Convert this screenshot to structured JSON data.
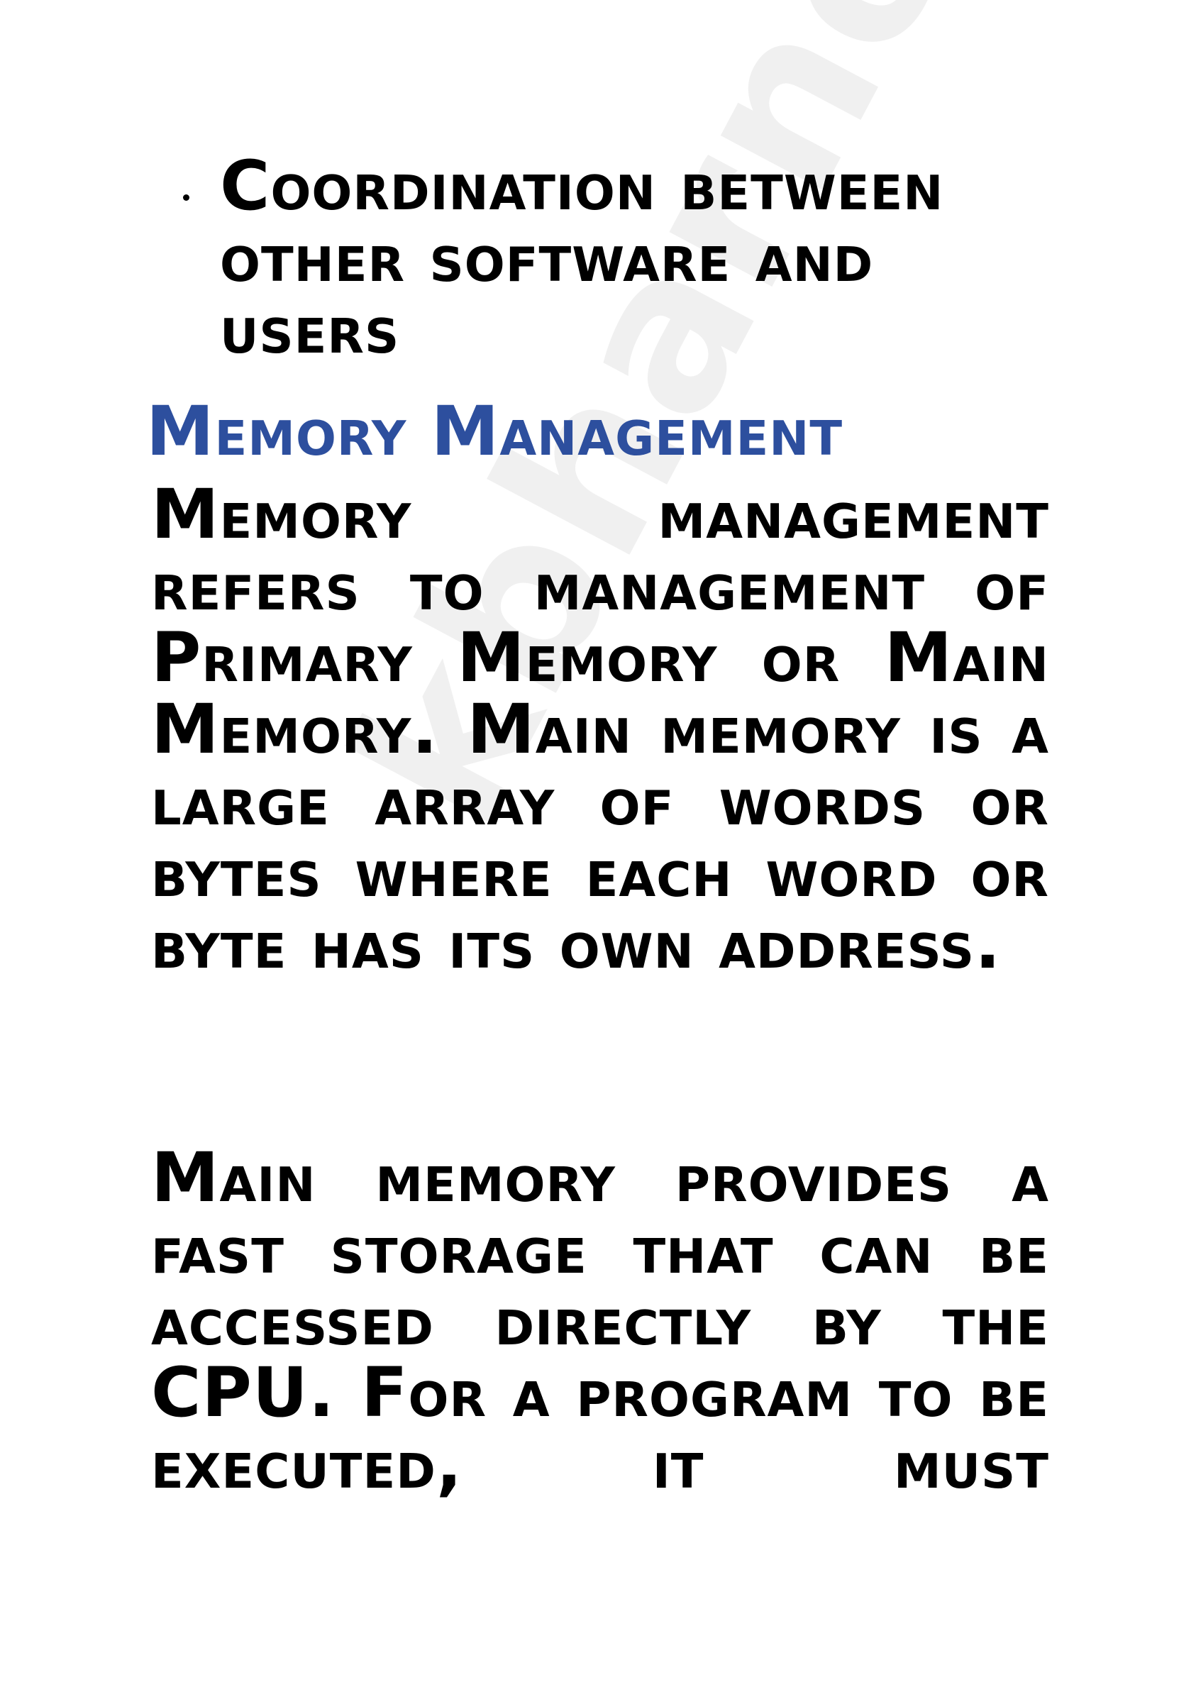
{
  "bullet": {
    "text": "Coordination between other software and users"
  },
  "section": {
    "heading": "Memory Management"
  },
  "paragraphs": [
    "Memory management refers to management of Primary Memory or Main Memory. Main memory is a large array of words or bytes where each word or byte has its own address.",
    "Main memory provides a fast storage that can be accessed directly by the CPU. For a program to be executed, it must"
  ],
  "watermark": {
    "text": "kbharnotes"
  },
  "colors": {
    "heading": "#2d4f9e",
    "text": "#000000",
    "background": "#ffffff"
  }
}
